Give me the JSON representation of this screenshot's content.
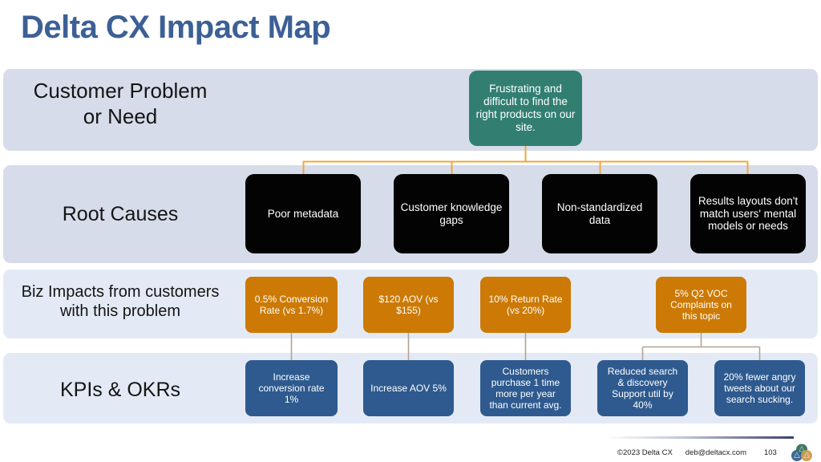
{
  "slide": {
    "title": "Delta CX Impact Map"
  },
  "rows": [
    {
      "label": "Customer Problem\nor Need"
    },
    {
      "label": "Root Causes"
    },
    {
      "label": "Biz Impacts from customers\nwith this problem"
    },
    {
      "label": "KPIs & OKRs"
    }
  ],
  "problem": {
    "text": "Frustrating and difficult to find the right products on our site."
  },
  "causes": [
    {
      "text": "Poor metadata"
    },
    {
      "text": "Customer knowledge gaps"
    },
    {
      "text": "Non-standardized data"
    },
    {
      "text": "Results layouts don't match users' mental models or needs"
    }
  ],
  "impacts": [
    {
      "text": "0.5% Conversion Rate (vs 1.7%)"
    },
    {
      "text": "$120 AOV (vs $155)"
    },
    {
      "text": "10% Return Rate (vs 20%)"
    },
    {
      "text": "5% Q2 VOC Complaints on this topic"
    }
  ],
  "kpis": [
    {
      "text": "Increase conversion rate 1%"
    },
    {
      "text": "Increase AOV 5%"
    },
    {
      "text": "Customers purchase 1 time more per year than current avg."
    },
    {
      "text": "Reduced search & discovery Support util by 40%"
    },
    {
      "text": "20% fewer angry tweets about our search sucking."
    }
  ],
  "footer": {
    "copyright": "©2023 Delta CX",
    "email": "deb@deltacx.com",
    "page": "103",
    "logo_icon": "delta-cx-logo-icon"
  },
  "colors": {
    "title": "#3C6095",
    "band_dark": "#D7DCEA",
    "band_light": "#E4EAF5",
    "problem_node": "#327F72",
    "cause_node": "#030303",
    "impact_node": "#CC7A05",
    "kpi_node": "#2E5A8F",
    "connector_orange": "#F0A73C",
    "connector_tan": "#B3A392"
  },
  "chart_data": {
    "type": "diagram",
    "title": "Delta CX Impact Map",
    "levels": [
      {
        "name": "Customer Problem or Need",
        "nodes": [
          "Frustrating and difficult to find the right products on our site."
        ]
      },
      {
        "name": "Root Causes",
        "nodes": [
          "Poor metadata",
          "Customer knowledge gaps",
          "Non-standardized data",
          "Results layouts don't match users' mental models or needs"
        ]
      },
      {
        "name": "Biz Impacts from customers with this problem",
        "nodes": [
          "0.5% Conversion Rate (vs 1.7%)",
          "$120 AOV (vs $155)",
          "10% Return Rate (vs 20%)",
          "5% Q2 VOC Complaints on this topic"
        ]
      },
      {
        "name": "KPIs & OKRs",
        "nodes": [
          "Increase conversion rate 1%",
          "Increase AOV 5%",
          "Customers purchase 1 time more per year than current avg.",
          "Reduced search & discovery Support util by 40%",
          "20% fewer angry tweets about our search sucking."
        ]
      }
    ]
  }
}
